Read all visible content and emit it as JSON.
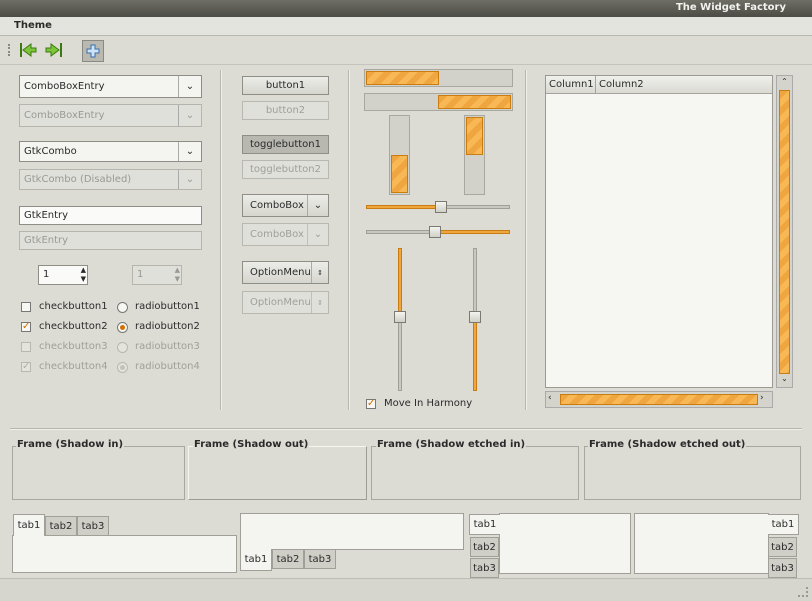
{
  "window": {
    "title": "The Widget Factory"
  },
  "menubar": {
    "items": [
      "Theme"
    ]
  },
  "toolbar": {
    "icons": [
      "back-icon",
      "forward-icon",
      "add-icon"
    ]
  },
  "column1": {
    "combo_entry": "ComboBoxEntry",
    "combo_entry_disabled": "ComboBoxEntry",
    "gtk_combo": "GtkCombo",
    "gtk_combo_disabled": "GtkCombo (Disabled)",
    "entry": "GtkEntry",
    "entry_disabled": "GtkEntry",
    "spin_value": "1",
    "spin_disabled_value": "1",
    "checkbuttons": [
      {
        "label": "checkbutton1",
        "checked": false,
        "disabled": false
      },
      {
        "label": "checkbutton2",
        "checked": true,
        "disabled": false
      },
      {
        "label": "checkbutton3",
        "checked": false,
        "disabled": true
      },
      {
        "label": "checkbutton4",
        "checked": true,
        "disabled": true
      }
    ],
    "radiobuttons": [
      {
        "label": "radiobutton1",
        "selected": false,
        "disabled": false
      },
      {
        "label": "radiobutton2",
        "selected": true,
        "disabled": false
      },
      {
        "label": "radiobutton3",
        "selected": false,
        "disabled": true
      },
      {
        "label": "radiobutton4",
        "selected": true,
        "disabled": true
      }
    ]
  },
  "column2": {
    "button1": "button1",
    "button2": "button2",
    "toggle1": "togglebutton1",
    "toggle2": "togglebutton2",
    "combobox": "ComboBox",
    "combobox_disabled": "ComboBox",
    "optionmenu": "OptionMenu",
    "optionmenu_disabled": "OptionMenu"
  },
  "column3": {
    "progress": {
      "h1": 0.5,
      "h2": 0.5,
      "v1": 0.5,
      "v2": 0.5
    },
    "hscale_values": [
      0.52,
      0.48
    ],
    "vscale_values": [
      0.48,
      0.48
    ],
    "move_in_harmony": "Move In Harmony",
    "move_in_harmony_checked": true
  },
  "tree": {
    "columns": [
      "Column1",
      "Column2"
    ]
  },
  "frames": [
    "Frame (Shadow in)",
    "Frame (Shadow out)",
    "Frame (Shadow etched in)",
    "Frame (Shadow etched out)"
  ],
  "notebooks": {
    "tabs": [
      "tab1",
      "tab2",
      "tab3"
    ]
  },
  "colors": {
    "accent": "#f0a640",
    "accent_border": "#c97d10",
    "bg": "#dcdcd5"
  }
}
